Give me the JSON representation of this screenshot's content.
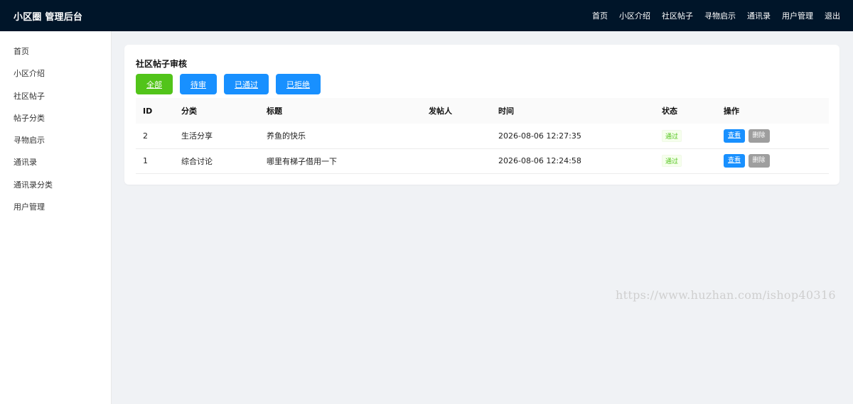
{
  "header": {
    "brand": "小区圈 管理后台",
    "nav": [
      "首页",
      "小区介绍",
      "社区帖子",
      "寻物启示",
      "通讯录",
      "用户管理",
      "退出"
    ]
  },
  "sidebar": {
    "items": [
      "首页",
      "小区介绍",
      "社区帖子",
      "帖子分类",
      "寻物启示",
      "通讯录",
      "通讯录分类",
      "用户管理"
    ]
  },
  "main": {
    "title": "社区帖子审核",
    "filters": [
      {
        "label": "全部",
        "color": "#52c41a"
      },
      {
        "label": "待审",
        "color": "#1890ff"
      },
      {
        "label": "已通过",
        "color": "#1890ff"
      },
      {
        "label": "已拒绝",
        "color": "#1890ff"
      }
    ],
    "table": {
      "columns": [
        "ID",
        "分类",
        "标题",
        "发帖人",
        "时间",
        "状态",
        "操作"
      ],
      "rows": [
        {
          "id": "2",
          "category": "生活分享",
          "title": "养鱼的快乐",
          "author": "",
          "time": "2026-08-06 12:27:35",
          "status": "通过"
        },
        {
          "id": "1",
          "category": "综合讨论",
          "title": "哪里有梯子借用一下",
          "author": "",
          "time": "2026-08-06 12:24:58",
          "status": "通过"
        }
      ],
      "actions": {
        "view": "查看",
        "delete": "删除"
      }
    }
  },
  "colors": {
    "view": "#1890ff",
    "delete": "#9e9e9e",
    "approved": "#52c41a"
  },
  "watermark": "https://www.huzhan.com/ishop40316"
}
